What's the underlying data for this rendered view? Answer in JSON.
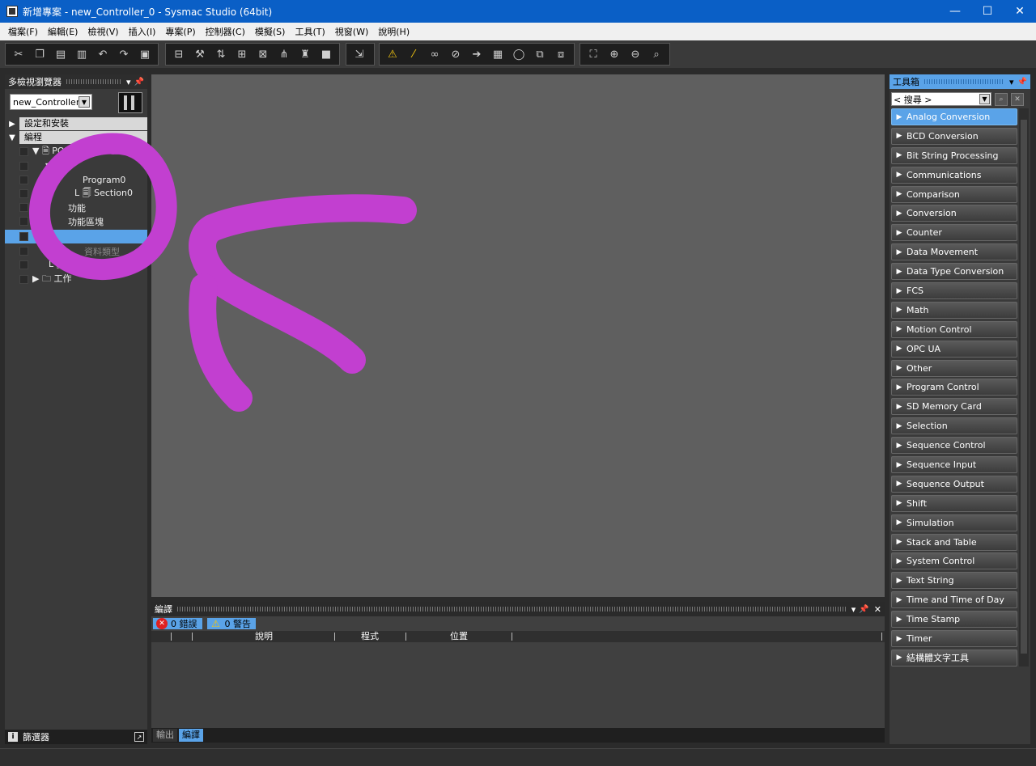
{
  "window": {
    "title": "新增專案 - new_Controller_0 - Sysmac Studio (64bit)"
  },
  "menu": [
    "檔案(F)",
    "編輯(E)",
    "檢視(V)",
    "插入(I)",
    "專案(P)",
    "控制器(C)",
    "模擬(S)",
    "工具(T)",
    "視窗(W)",
    "說明(H)"
  ],
  "toolbar_icons": [
    "cut-icon",
    "copy-icon",
    "paste-icon",
    "delete-icon",
    "undo-icon",
    "redo-icon",
    "help-icon",
    "online-icon",
    "build-icon",
    "sync-icon",
    "transfer-icon",
    "compare-icon",
    "monitor-icon",
    "find-icon",
    "stop-icon",
    "cross-ref-icon",
    "warning-icon",
    "axis-icon",
    "link-icon",
    "unlink-icon",
    "step-icon",
    "layer-icon",
    "cycle-icon",
    "zoom-window-icon",
    "restore-icon",
    "fit-icon",
    "zoom-in-icon",
    "zoom-out-icon",
    "zoom-area-icon"
  ],
  "left_pane": {
    "title": "多檢視瀏覽器",
    "controller": "new_Controller_0",
    "sections": [
      {
        "label": "設定和安裝",
        "arrow": "▶"
      },
      {
        "label": "編程",
        "arrow": "▼"
      }
    ],
    "tree": [
      {
        "text": "▼ 🗎 POU"
      },
      {
        "text": "▼"
      },
      {
        "text": "Program0"
      },
      {
        "text": "L 🗐 Section0"
      },
      {
        "text": "功能"
      },
      {
        "text": "功能區塊"
      },
      {
        "text": "▼"
      },
      {
        "text": "資料類型"
      },
      {
        "text": "L 🗐"
      },
      {
        "text": "▶ 🗀 工作"
      }
    ],
    "filter_label": "篩選器"
  },
  "build_pane": {
    "title": "編譯",
    "errors": "0 錯誤",
    "warnings": "0 警告",
    "columns": [
      "說明",
      "程式",
      "位置"
    ]
  },
  "bottom_tabs": {
    "output": "輸出",
    "build": "編譯"
  },
  "toolbox": {
    "title": "工具箱",
    "search_placeholder": "< 搜尋 >",
    "items": [
      "Analog Conversion",
      "BCD Conversion",
      "Bit String Processing",
      "Communications",
      "Comparison",
      "Conversion",
      "Counter",
      "Data Movement",
      "Data Type Conversion",
      "FCS",
      "Math",
      "Motion Control",
      "OPC UA",
      "Other",
      "Program Control",
      "SD Memory Card",
      "Selection",
      "Sequence Control",
      "Sequence Input",
      "Sequence Output",
      "Shift",
      "Simulation",
      "Stack and Table",
      "System Control",
      "Text String",
      "Time and Time of Day",
      "Time Stamp",
      "Timer",
      "結構體文字工具"
    ]
  },
  "colors": {
    "selection": "#5aa3e8",
    "annotation": "#c23fd0",
    "titlebar": "#0a5fc6"
  }
}
